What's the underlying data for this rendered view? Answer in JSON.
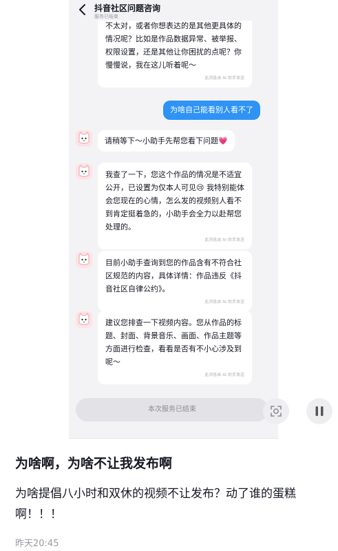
{
  "chat": {
    "title": "抖音社区问题咨询",
    "subtitle": "服务已结束",
    "messages": [
      {
        "text": "不太对，或者你想表达的是其他更具体的情况呢？比如是作品数据异常、被举报、权限设置，还是其他让你困扰的点呢？你慢慢说，我在这儿听着呢～",
        "footer": "此消息由 AI 助手发送"
      },
      {
        "text": "为啥自己能看别人看不了"
      },
      {
        "text": "请稍等下～小助手先帮您看下问题💗"
      },
      {
        "text": "我查了一下，您这个作品的情况是不适宜公开，已设置为仅本人可见😢 我特别能体会您现在的心情，怎么发的视频别人看不到肯定挺着急的，小助手会全力以赴帮您处理的。",
        "footer": "此消息由 AI 助手发送"
      },
      {
        "text": "目前小助手查询到您的作品含有不符合社区规范的内容，具体详情：作品违反《抖音社区自律公约》。",
        "footer": "此消息由 AI 助手发送"
      },
      {
        "text": "建议您排查一下视频内容。您从作品的标题、封面、背景音乐、画面、作品主题等方面进行检查，看看是否有不小心涉及到呢～",
        "footer": "此消息由 AI 助手发送"
      }
    ],
    "end_label": "本次服务已结束",
    "icons": {
      "back": "chevron-left-icon",
      "scan": "scan-icon",
      "pause": "pause-icon"
    },
    "colors": {
      "user_bubble": "#2e93f5",
      "avatar_bg": "#fde3e6"
    }
  },
  "post": {
    "title": "为啥啊，为啥不让我发布啊",
    "body": "为啥提倡八小时和双休的视频不让发布？动了谁的蛋糕啊！！！",
    "time": "昨天20:45"
  }
}
